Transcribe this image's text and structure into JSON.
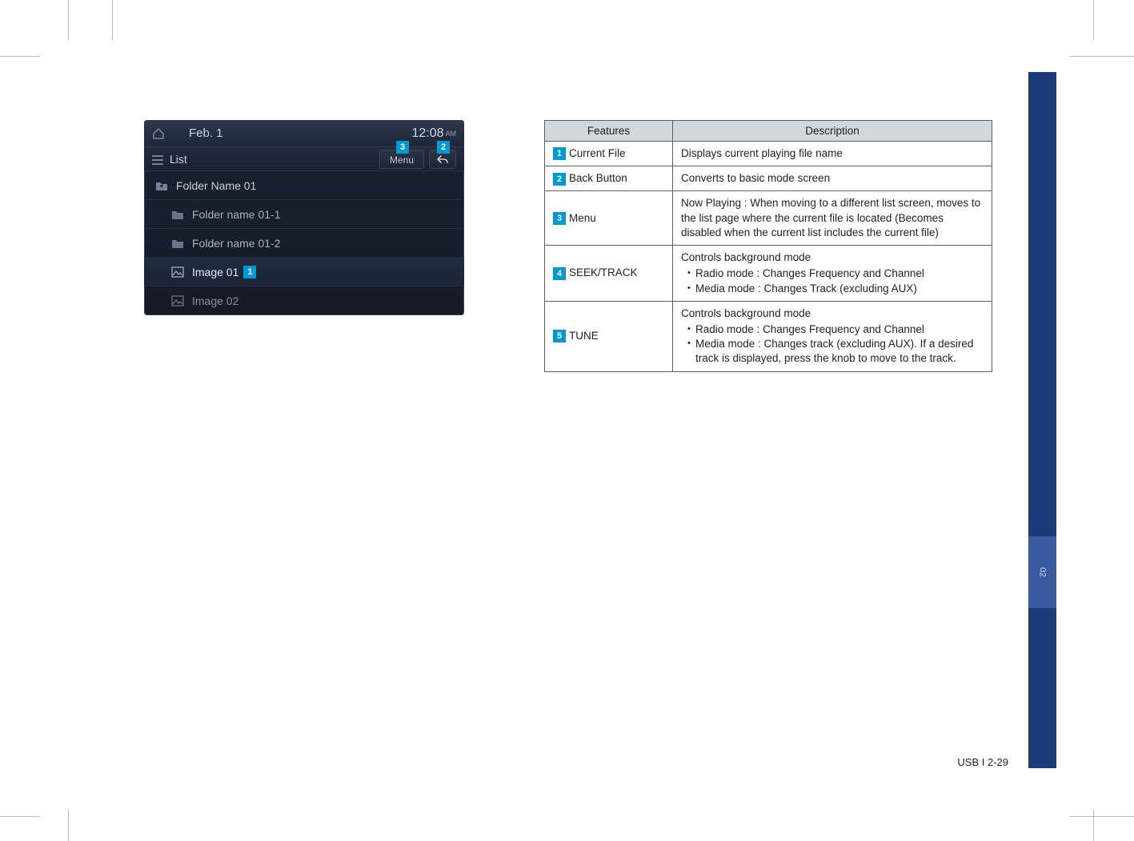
{
  "sidetab": "02",
  "device": {
    "date": "Feb.  1",
    "time": "12:08",
    "ampm": "AM",
    "list_label": "List",
    "menu_label": "Menu",
    "rows": {
      "folder_top": "Folder Name 01",
      "folder_sub1": "Folder name 01-1",
      "folder_sub2": "Folder name 01-2",
      "image1": "Image 01",
      "image2": "Image 02"
    },
    "callouts": {
      "current_file": "1",
      "back": "2",
      "menu": "3"
    }
  },
  "table": {
    "head_features": "Features",
    "head_description": "Description",
    "rows": [
      {
        "num": "1",
        "name": "Current File",
        "desc": "Displays current playing file name"
      },
      {
        "num": "2",
        "name": "Back Button",
        "desc": "Converts to basic mode screen"
      },
      {
        "num": "3",
        "name": "Menu",
        "desc": "Now Playing : When moving to a different list screen, moves to the list page where the current file is located (Becomes disabled when the current list includes the current file)"
      },
      {
        "num": "4",
        "name": "SEEK/TRACK",
        "desc_lead": "Controls background mode",
        "bullets": [
          "Radio mode : Changes Frequency and Channel",
          "Media mode : Changes Track (excluding AUX)"
        ]
      },
      {
        "num": "5",
        "name": "TUNE",
        "desc_lead": "Controls background mode",
        "bullets": [
          "Radio mode : Changes Frequency and Channel",
          "Media mode : Changes track (excluding AUX). If a desired track is displayed, press the knob to move to the track."
        ]
      }
    ]
  },
  "footer": "USB I 2-29"
}
